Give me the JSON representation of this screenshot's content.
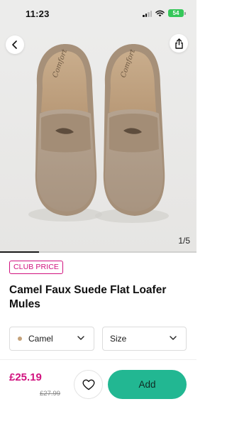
{
  "status_bar": {
    "time": "11:23",
    "battery": "54"
  },
  "gallery": {
    "counter": "1/5",
    "current_image": 1,
    "total_images": 5,
    "back_icon": "chevron-left-icon",
    "share_icon": "share-icon"
  },
  "product": {
    "badge": "CLUB PRICE",
    "title": "Camel Faux Suede Flat Loafer Mules"
  },
  "options": {
    "colour": {
      "selected": "Camel",
      "swatch_color": "#c4a27a"
    },
    "size": {
      "placeholder": "Size"
    }
  },
  "purchase": {
    "price": "£25.19",
    "was_price": "£27.99",
    "add_label": "Add",
    "wishlist_icon": "heart-icon"
  },
  "colors": {
    "accent_pink": "#d1127f",
    "add_button": "#22b792"
  }
}
